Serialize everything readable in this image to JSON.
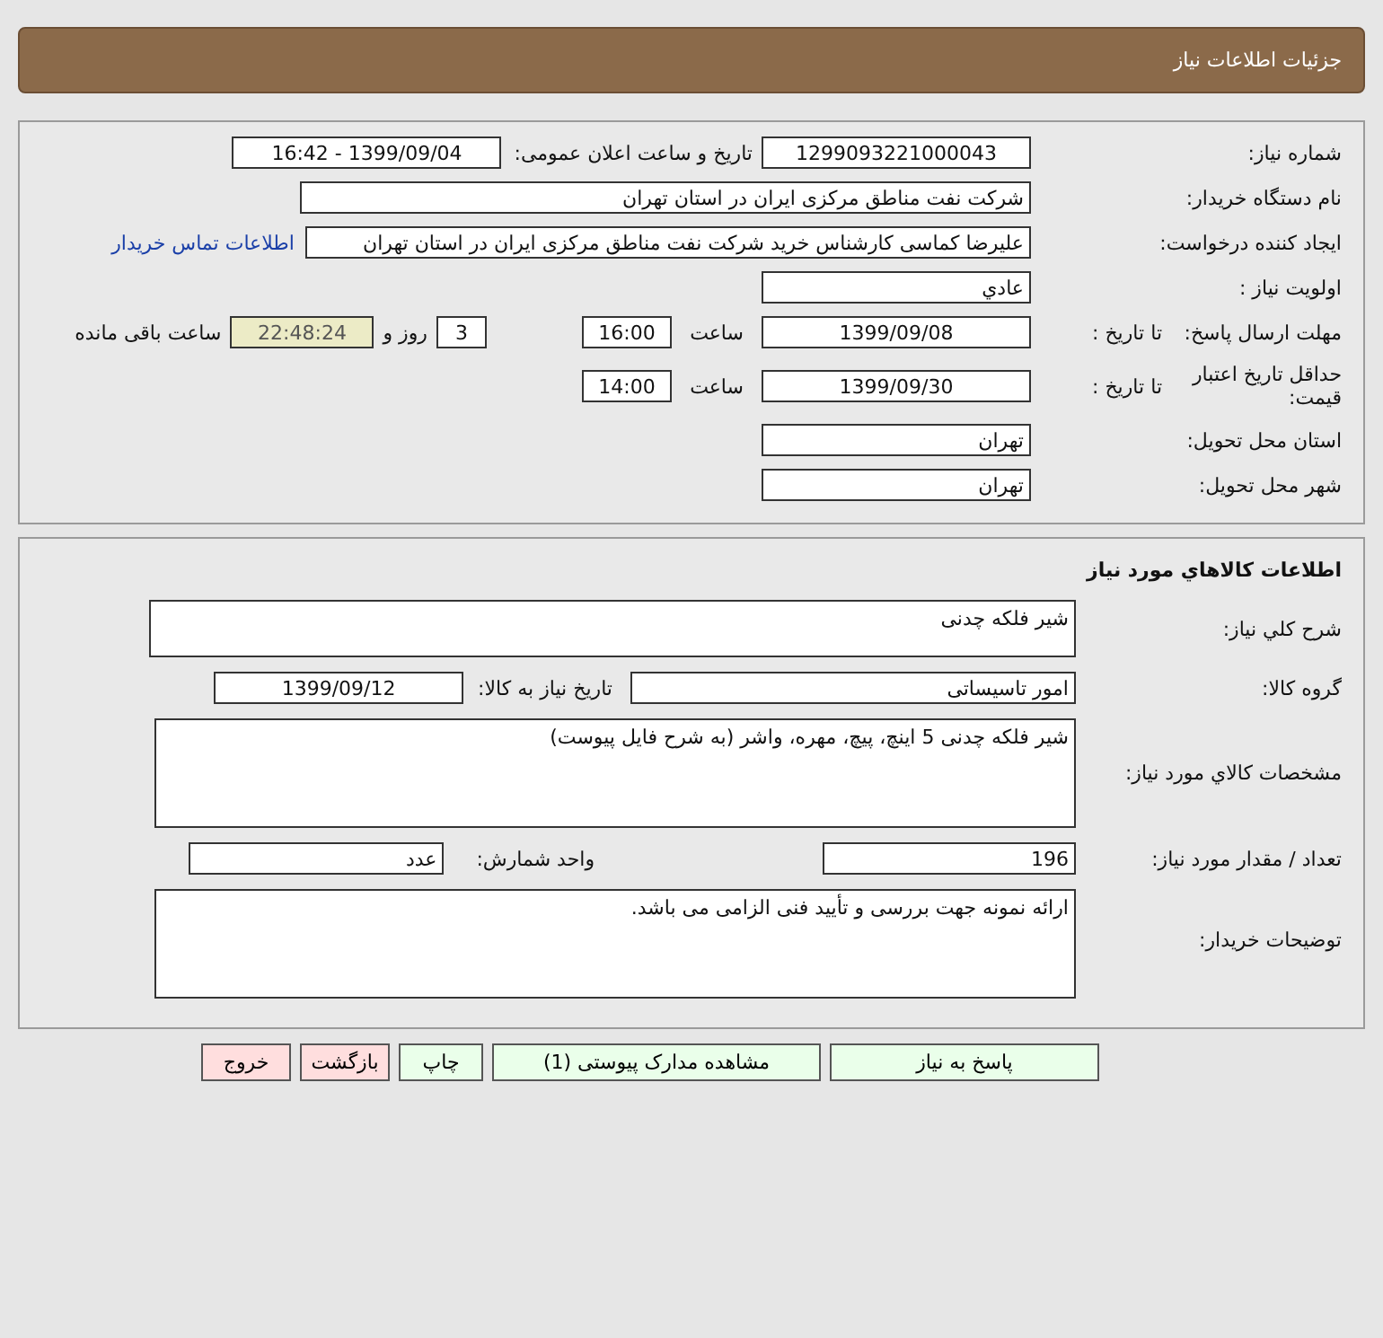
{
  "header": {
    "title": "جزئیات اطلاعات نیاز"
  },
  "details": {
    "need_number": {
      "label": "شماره نیاز:",
      "value": "1299093221000043"
    },
    "announce": {
      "label": "تاریخ و ساعت اعلان عمومی:",
      "value": "1399/09/04 - 16:42"
    },
    "buyer": {
      "label": "نام دستگاه خریدار:",
      "value": "شرکت نفت مناطق مرکزی ایران در استان تهران"
    },
    "creator": {
      "label": "ایجاد کننده درخواست:",
      "value": "علیرضا کماسی کارشناس خرید شرکت نفت مناطق مرکزی ایران در استان تهران",
      "link": "اطلاعات تماس خریدار"
    },
    "priority": {
      "label": "اولویت نیاز :",
      "value": "عادي"
    },
    "deadline": {
      "label": "مهلت ارسال پاسخ:",
      "sublabel": "تا تاریخ :",
      "date": "1399/09/08",
      "time_label": "ساعت",
      "time": "16:00",
      "days": "3",
      "days_label": "روز و",
      "remaining": "22:48:24",
      "remaining_label": "ساعت باقی مانده"
    },
    "validity": {
      "label": "حداقل تاریخ اعتبار قیمت:",
      "sublabel": "تا تاریخ :",
      "date": "1399/09/30",
      "time_label": "ساعت",
      "time": "14:00"
    },
    "province": {
      "label": "استان محل تحویل:",
      "value": "تهران"
    },
    "city": {
      "label": "شهر محل تحویل:",
      "value": "تهران"
    }
  },
  "goods": {
    "title": "اطلاعات کالاهاي مورد نیاز",
    "summary": {
      "label": "شرح کلي نیاز:",
      "value": "شیر فلکه چدنی"
    },
    "group": {
      "label": "گروه کالا:",
      "value": "امور تاسیساتی",
      "date_label": "تاریخ نیاز به کالا:",
      "date": "1399/09/12"
    },
    "specs": {
      "label": "مشخصات کالاي مورد نیاز:",
      "value": "شیر فلکه چدنی 5 اینچ، پیچ، مهره، واشر (به شرح فایل پیوست)"
    },
    "quantity": {
      "label": "تعداد / مقدار مورد نیاز:",
      "value": "196",
      "unit_label": "واحد شمارش:",
      "unit": "عدد"
    },
    "notes": {
      "label": "توضیحات خریدار:",
      "value": "ارائه نمونه جهت بررسی و تأیید فنی الزامی می باشد."
    }
  },
  "buttons": [
    {
      "label": "پاسخ به نیاز",
      "kind": "go"
    },
    {
      "label": "مشاهده مدارک پیوستی (1)",
      "kind": "go"
    },
    {
      "label": "چاپ",
      "kind": "go"
    },
    {
      "label": "بازگشت",
      "kind": "stop"
    },
    {
      "label": "خروج",
      "kind": "stop"
    }
  ]
}
